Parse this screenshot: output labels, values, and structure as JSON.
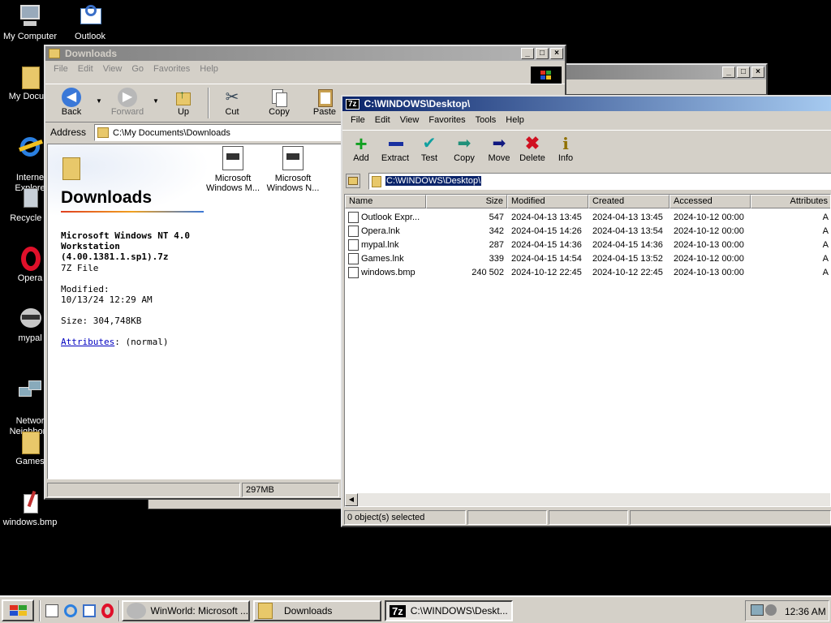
{
  "desktop": {
    "icons": [
      {
        "label": "My Computer",
        "icon": "computer-icon"
      },
      {
        "label": "Outlook",
        "icon": "outlook-icon"
      },
      {
        "label": "My Docum",
        "icon": "folder-icon"
      },
      {
        "label": "Interne\nExplore",
        "icon": "ie-icon"
      },
      {
        "label": "Recycle B",
        "icon": "recycle-bin-icon"
      },
      {
        "label": "Opera",
        "icon": "opera-icon"
      },
      {
        "label": "mypal",
        "icon": "mypal-icon"
      },
      {
        "label": "Networ\nNeighborh",
        "icon": "network-icon"
      },
      {
        "label": "Games",
        "icon": "folder-icon"
      },
      {
        "label": "windows.bmp",
        "icon": "paint-icon"
      }
    ]
  },
  "explorer": {
    "title": "Downloads",
    "menu": [
      "File",
      "Edit",
      "View",
      "Go",
      "Favorites",
      "Help"
    ],
    "toolbar": {
      "back": "Back",
      "forward": "Forward",
      "up": "Up",
      "cut": "Cut",
      "copy": "Copy",
      "paste": "Paste"
    },
    "address_label": "Address",
    "address_value": "C:\\My Documents\\Downloads",
    "folder_title": "Downloads",
    "selected_name": "Microsoft Windows NT 4.0 Workstation (4.00.1381.1.sp1).7z",
    "selected_type": "7Z File",
    "modified_label": "Modified:",
    "modified_value": "10/13/24 12:29 AM",
    "size_label": "Size: 304,748KB",
    "attributes_link": "Attributes",
    "attributes_value": ": (normal)",
    "files": [
      {
        "line1": "Microsoft",
        "line2": "Windows M..."
      },
      {
        "line1": "Microsoft",
        "line2": "Windows N..."
      }
    ],
    "status_size": "297MB"
  },
  "sevenzip": {
    "title": "C:\\WINDOWS\\Desktop\\",
    "menu": [
      "File",
      "Edit",
      "View",
      "Favorites",
      "Tools",
      "Help"
    ],
    "toolbar": [
      "Add",
      "Extract",
      "Test",
      "Copy",
      "Move",
      "Delete",
      "Info"
    ],
    "path": "C:\\WINDOWS\\Desktop\\",
    "columns": [
      "Name",
      "Size",
      "Modified",
      "Created",
      "Accessed",
      "Attributes"
    ],
    "rows": [
      {
        "name": "Outlook Expr...",
        "size": "547",
        "modified": "2024-04-13 13:45",
        "created": "2024-04-13 13:45",
        "accessed": "2024-10-12 00:00",
        "attr": "A"
      },
      {
        "name": "Opera.lnk",
        "size": "342",
        "modified": "2024-04-15 14:26",
        "created": "2024-04-13 13:54",
        "accessed": "2024-10-12 00:00",
        "attr": "A"
      },
      {
        "name": "mypal.lnk",
        "size": "287",
        "modified": "2024-04-15 14:36",
        "created": "2024-04-15 14:36",
        "accessed": "2024-10-13 00:00",
        "attr": "A"
      },
      {
        "name": "Games.lnk",
        "size": "339",
        "modified": "2024-04-15 14:54",
        "created": "2024-04-15 13:52",
        "accessed": "2024-10-12 00:00",
        "attr": "A"
      },
      {
        "name": "windows.bmp",
        "size": "240 502",
        "modified": "2024-10-12 22:45",
        "created": "2024-10-12 22:45",
        "accessed": "2024-10-13 00:00",
        "attr": "A"
      }
    ],
    "status": "0 object(s) selected"
  },
  "taskbar": {
    "tasks": [
      "WinWorld: Microsoft ...",
      "Downloads",
      "C:\\WINDOWS\\Deskt..."
    ],
    "clock": "12:36 AM"
  }
}
